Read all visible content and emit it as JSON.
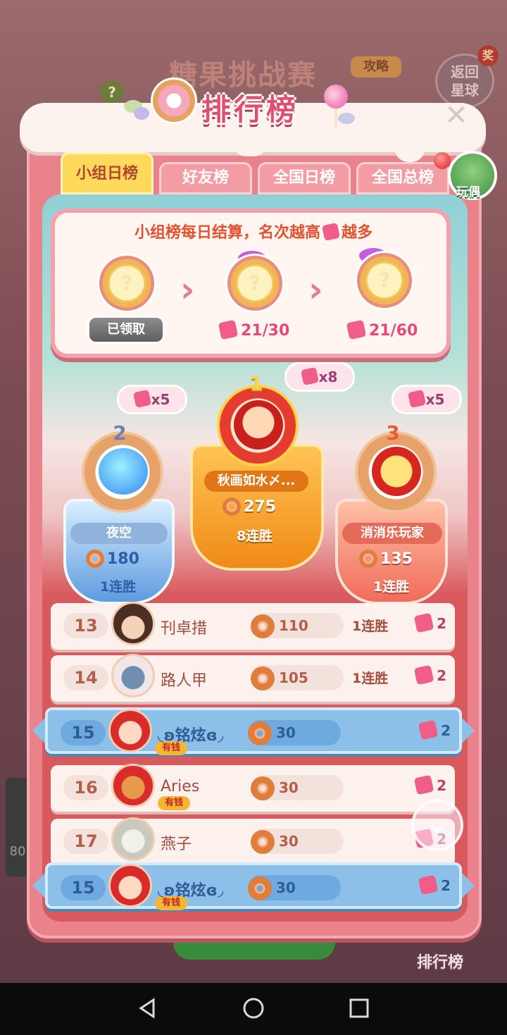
{
  "background": {
    "event_title": "糖果挑战赛",
    "strategy_label": "攻略",
    "return_label_1": "返回",
    "return_label_2": "星球",
    "prize_label": "奖",
    "help_label": "?",
    "rank_button": "排行榜",
    "side_value": "80"
  },
  "dialog": {
    "title": "排行榜",
    "close_icon": "close-icon"
  },
  "tabs": [
    {
      "label": "小组日榜",
      "active": true
    },
    {
      "label": "好友榜",
      "active": false
    },
    {
      "label": "全国日榜",
      "active": false
    },
    {
      "label": "全国总榜",
      "active": false
    }
  ],
  "toy_button": {
    "label": "玩偶"
  },
  "reward_info": {
    "text_before": "小组榜每日结算，名次越高",
    "text_after": "越多",
    "claimed_label": "已领取",
    "progress_2": "21/30",
    "progress_3": "21/60",
    "chest_mark": "?"
  },
  "podium": {
    "first": {
      "rank": "1",
      "name": "秋画如水〆...",
      "score": "275",
      "streak": "8连胜",
      "reward": "x8"
    },
    "second": {
      "rank": "2",
      "name": "夜空",
      "score": "180",
      "streak": "1连胜",
      "reward": "x5"
    },
    "third": {
      "rank": "3",
      "name": "消消乐玩家",
      "score": "135",
      "streak": "1连胜",
      "reward": "x5"
    }
  },
  "rows": [
    {
      "rank": "13",
      "name": "刊卓措",
      "score": "110",
      "streak": "1连胜",
      "pieces": "2",
      "me": false
    },
    {
      "rank": "14",
      "name": "路人甲",
      "score": "105",
      "streak": "1连胜",
      "pieces": "2",
      "me": false
    },
    {
      "rank": "15",
      "name": "◟ʚ铭炫ɞ◞",
      "score": "30",
      "streak": "",
      "pieces": "2",
      "me": true,
      "badge": "有钱"
    },
    {
      "rank": "16",
      "name": "Aries",
      "score": "30",
      "streak": "",
      "pieces": "2",
      "me": false,
      "badge": "有钱"
    },
    {
      "rank": "17",
      "name": "燕子",
      "score": "30",
      "streak": "",
      "pieces": "2",
      "me": false
    }
  ],
  "my_row": {
    "rank": "15",
    "name": "◟ʚ铭炫ɞ◞",
    "score": "30",
    "pieces": "2",
    "badge": "有钱"
  },
  "colors": {
    "panel": "#e9828a",
    "tab_active": "#ffd95b",
    "gold": "#f08a17",
    "silver": "#5f9be0",
    "bronze": "#f06c5a",
    "me_row": "#8cc0e8"
  }
}
